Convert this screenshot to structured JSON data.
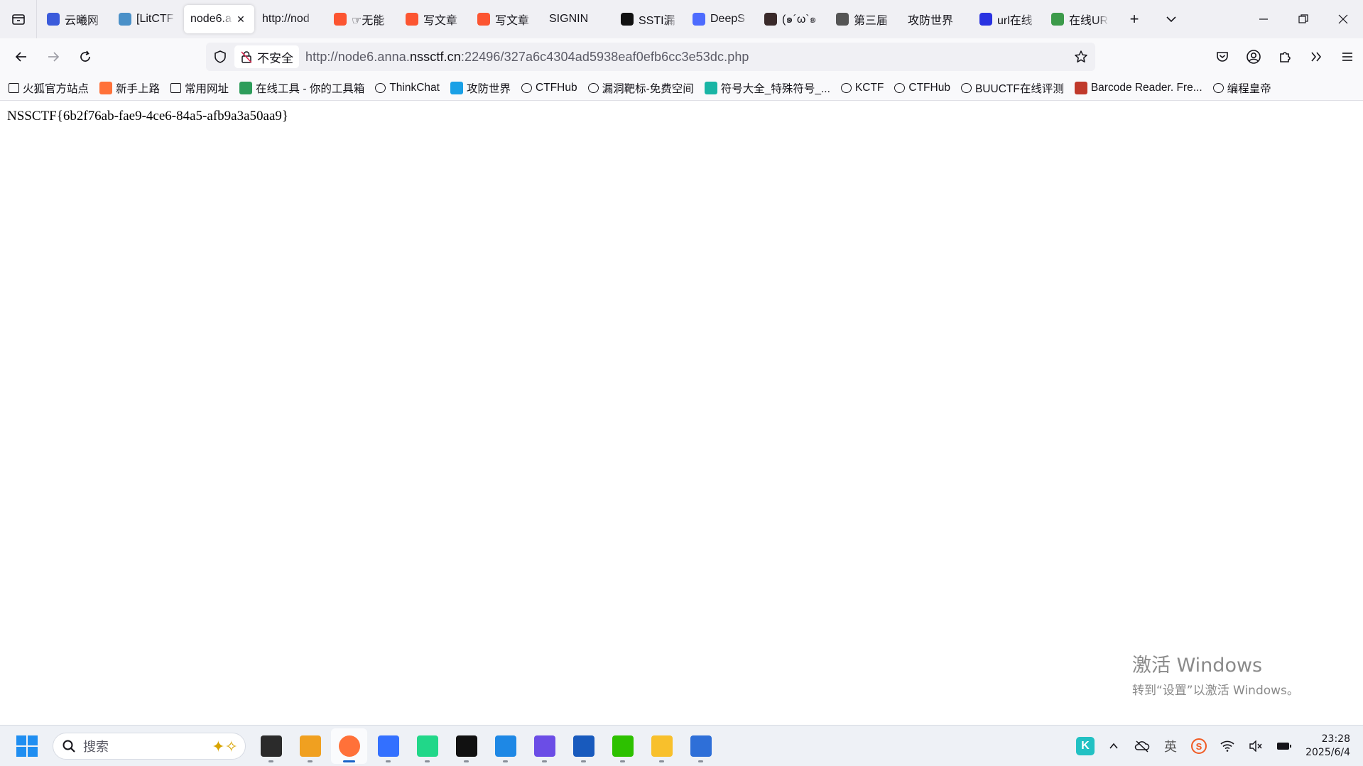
{
  "browser": {
    "tabs": [
      {
        "label": "云曦网",
        "icon": "globe-blue-icon",
        "color": "#3b5bdb"
      },
      {
        "label": "[LitCTF",
        "icon": "site-icon",
        "color": "#4a90c8"
      },
      {
        "label": "node6.a",
        "icon": "",
        "color": "",
        "active": true
      },
      {
        "label": "http://nod",
        "icon": "",
        "color": ""
      },
      {
        "label": "☞无能",
        "icon": "csdn-icon",
        "color": "#fc5531"
      },
      {
        "label": "写文章",
        "icon": "csdn-icon",
        "color": "#fc5531"
      },
      {
        "label": "写文章",
        "icon": "csdn-icon",
        "color": "#fc5531"
      },
      {
        "label": "SIGNIN",
        "icon": "",
        "color": ""
      },
      {
        "label": "SSTI漏",
        "icon": "k-icon",
        "color": "#111111"
      },
      {
        "label": "DeepS",
        "icon": "deepseek-icon",
        "color": "#4d6bfe"
      },
      {
        "label": "(๑´ω`๑",
        "icon": "avatar-icon",
        "color": "#3a2a2a"
      },
      {
        "label": "第三届",
        "icon": "bulb-icon",
        "color": "#555555"
      },
      {
        "label": "攻防世界",
        "icon": "",
        "color": ""
      },
      {
        "label": "url在线",
        "icon": "baidu-icon",
        "color": "#2932e1"
      },
      {
        "label": "在线UR",
        "icon": "site-green-icon",
        "color": "#3c9a4a"
      }
    ],
    "address": {
      "security_label": "不安全",
      "url_prefix": "http://node6.anna.",
      "url_domain": "nssctf.cn",
      "url_suffix": ":22496/327a6c4304ad5938eaf0efb6cc3e53dc.php"
    },
    "bookmarks": [
      {
        "label": "火狐官方站点",
        "icon": "folder-icon"
      },
      {
        "label": "新手上路",
        "icon": "firefox-icon"
      },
      {
        "label": "常用网址",
        "icon": "folder-icon"
      },
      {
        "label": "在线工具 - 你的工具箱",
        "icon": "tool-icon"
      },
      {
        "label": "ThinkChat",
        "icon": "globe-icon"
      },
      {
        "label": "攻防世界",
        "icon": "adworld-icon"
      },
      {
        "label": "CTFHub",
        "icon": "cube-icon"
      },
      {
        "label": "漏洞靶标-免费空间",
        "icon": "spider-icon"
      },
      {
        "label": "符号大全_特殊符号_...",
        "icon": "ke-icon"
      },
      {
        "label": "KCTF",
        "icon": "snowflake-icon"
      },
      {
        "label": "CTFHub",
        "icon": "cube-icon"
      },
      {
        "label": "BUUCTF在线评测",
        "icon": "buu-icon"
      },
      {
        "label": "Barcode Reader. Fre...",
        "icon": "barcode-icon"
      },
      {
        "label": "编程皇帝",
        "icon": "globe-icon"
      }
    ]
  },
  "page": {
    "flag_text": "NSSCTF{6b2f76ab-fae9-4ce6-84a5-afb9a3a50aa9}"
  },
  "watermark": {
    "title": "激活 Windows",
    "subtitle": "转到“设置”以激活 Windows。"
  },
  "taskbar": {
    "search_placeholder": "搜索",
    "apps": [
      {
        "name": "task-view-icon",
        "color": "#2b2b2b"
      },
      {
        "name": "remote-desktop-icon",
        "color": "#f0a020"
      },
      {
        "name": "firefox-icon",
        "color": "#ff7139",
        "active": true
      },
      {
        "name": "feishu-icon",
        "color": "#3370ff"
      },
      {
        "name": "pycharm-icon",
        "color": "#21d789"
      },
      {
        "name": "behance-icon",
        "color": "#111111"
      },
      {
        "name": "notepad-icon",
        "color": "#1e88e5"
      },
      {
        "name": "vscode-icon",
        "color": "#6b4de6"
      },
      {
        "name": "word-icon",
        "color": "#185abd"
      },
      {
        "name": "wechat-icon",
        "color": "#2dc100"
      },
      {
        "name": "file-explorer-icon",
        "color": "#f8c02c"
      },
      {
        "name": "vpn-icon",
        "color": "#2e6fd8"
      }
    ],
    "clock_time": "23:28",
    "clock_date": "2025/6/4"
  }
}
